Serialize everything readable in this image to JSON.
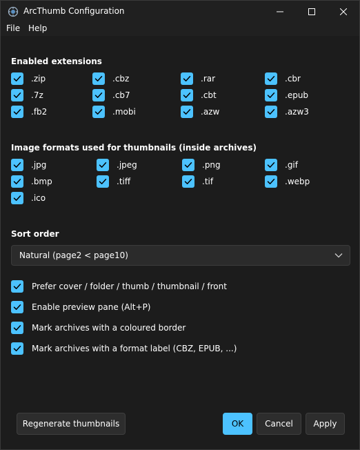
{
  "window": {
    "title": "ArcThumb Configuration",
    "accent": "#4cc2ff",
    "background": "#202020"
  },
  "menu": {
    "file": "File",
    "help": "Help"
  },
  "extensions": {
    "title": "Enabled extensions",
    "items": [
      {
        "label": ".zip",
        "checked": true
      },
      {
        "label": ".cbz",
        "checked": true
      },
      {
        "label": ".rar",
        "checked": true
      },
      {
        "label": ".cbr",
        "checked": true
      },
      {
        "label": ".7z",
        "checked": true
      },
      {
        "label": ".cb7",
        "checked": true
      },
      {
        "label": ".cbt",
        "checked": true
      },
      {
        "label": ".epub",
        "checked": true
      },
      {
        "label": ".fb2",
        "checked": true
      },
      {
        "label": ".mobi",
        "checked": true
      },
      {
        "label": ".azw",
        "checked": true
      },
      {
        "label": ".azw3",
        "checked": true
      }
    ]
  },
  "formats": {
    "title": "Image formats used for thumbnails (inside archives)",
    "items": [
      {
        "label": ".jpg",
        "checked": true
      },
      {
        "label": ".jpeg",
        "checked": true
      },
      {
        "label": ".png",
        "checked": true
      },
      {
        "label": ".gif",
        "checked": true
      },
      {
        "label": ".bmp",
        "checked": true
      },
      {
        "label": ".tiff",
        "checked": true
      },
      {
        "label": ".tif",
        "checked": true
      },
      {
        "label": ".webp",
        "checked": true
      },
      {
        "label": ".ico",
        "checked": true
      }
    ]
  },
  "sort": {
    "title": "Sort order",
    "value": "Natural (page2 < page10)"
  },
  "options": [
    {
      "label": "Prefer cover / folder / thumb / thumbnail / front",
      "checked": true
    },
    {
      "label": "Enable preview pane (Alt+P)",
      "checked": true
    },
    {
      "label": "Mark archives with a coloured border",
      "checked": true
    },
    {
      "label": "Mark archives with a format label (CBZ, EPUB, ...)",
      "checked": true
    }
  ],
  "buttons": {
    "regenerate": "Regenerate thumbnails",
    "ok": "OK",
    "cancel": "Cancel",
    "apply": "Apply"
  }
}
